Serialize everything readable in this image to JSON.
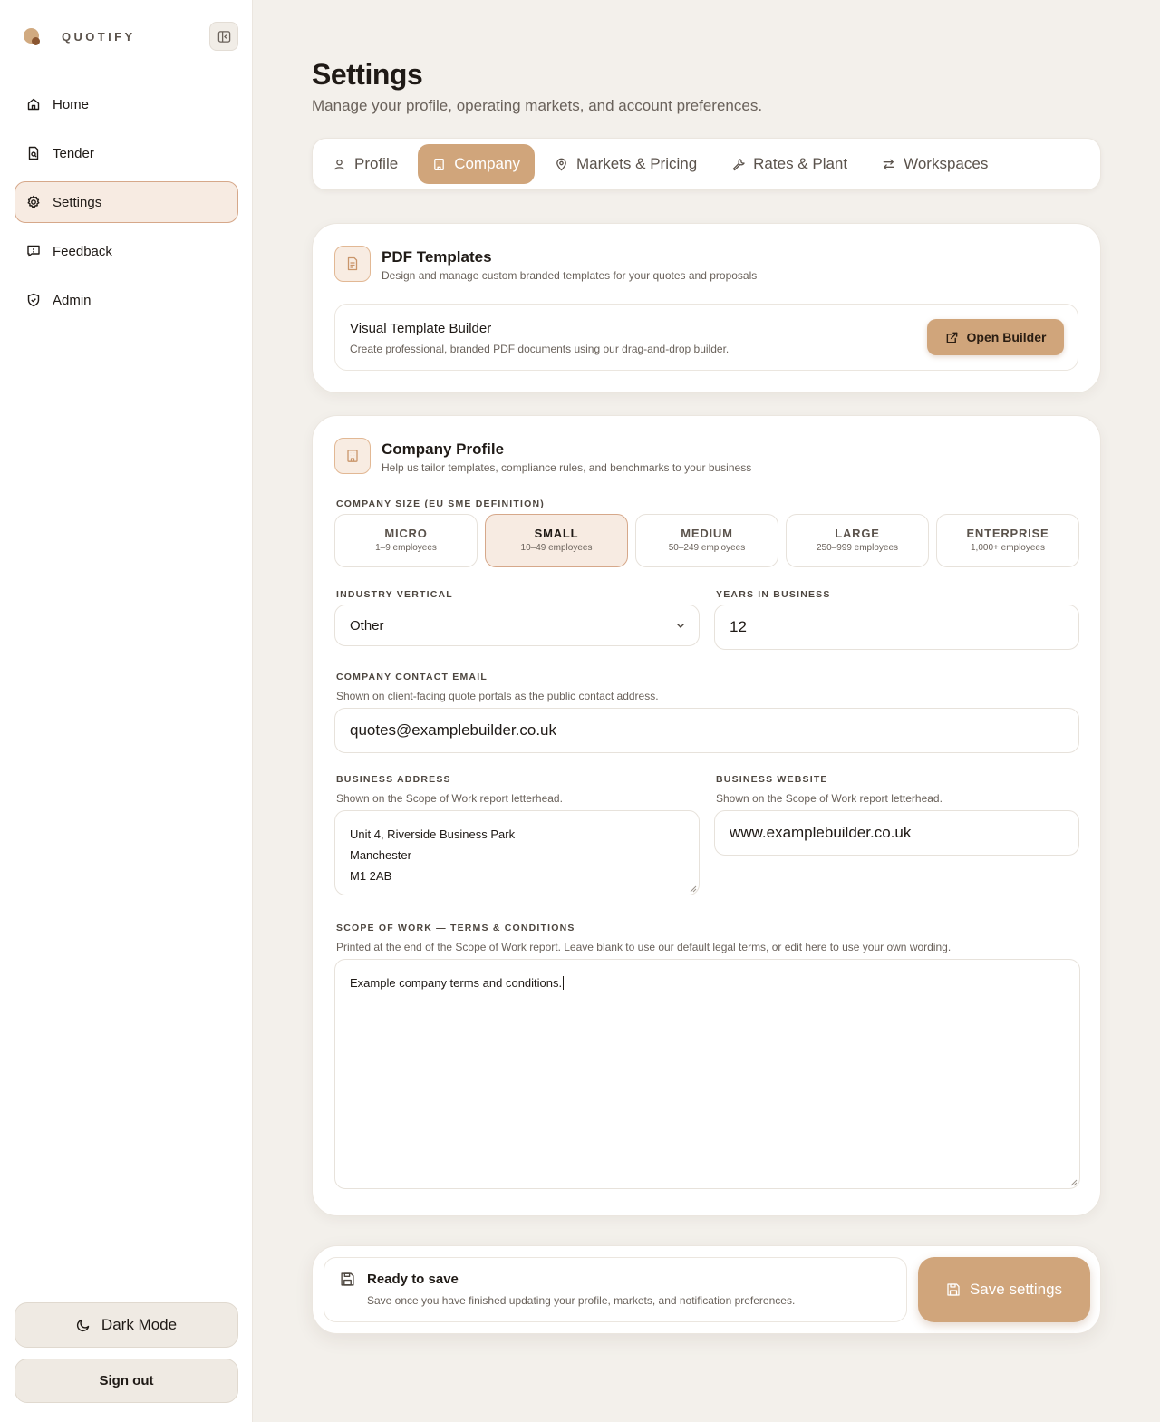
{
  "brand": {
    "name": "QUOTIFY"
  },
  "sidebar": {
    "items": [
      {
        "label": "Home",
        "icon": "home-icon",
        "active": false
      },
      {
        "label": "Tender",
        "icon": "file-icon",
        "active": false
      },
      {
        "label": "Settings",
        "icon": "gear-icon",
        "active": true
      },
      {
        "label": "Feedback",
        "icon": "message-icon",
        "active": false
      },
      {
        "label": "Admin",
        "icon": "shield-icon",
        "active": false
      }
    ],
    "dark_mode_label": "Dark Mode",
    "sign_out_label": "Sign out"
  },
  "header": {
    "title": "Settings",
    "subtitle": "Manage your profile, operating markets, and account preferences."
  },
  "tabs": [
    {
      "label": "Profile",
      "icon": "user-icon",
      "active": false
    },
    {
      "label": "Company",
      "icon": "building-icon",
      "active": true
    },
    {
      "label": "Markets & Pricing",
      "icon": "map-pin-icon",
      "active": false
    },
    {
      "label": "Rates & Plant",
      "icon": "wrench-icon",
      "active": false
    },
    {
      "label": "Workspaces",
      "icon": "swap-icon",
      "active": false
    }
  ],
  "pdf_templates": {
    "title": "PDF Templates",
    "description": "Design and manage custom branded templates for your quotes and proposals",
    "builder_title": "Visual Template Builder",
    "builder_description": "Create professional, branded PDF documents using our drag-and-drop builder.",
    "open_builder_label": "Open Builder"
  },
  "company_profile": {
    "title": "Company Profile",
    "description": "Help us tailor templates, compliance rules, and benchmarks to your business",
    "size_label": "COMPANY SIZE (EU SME DEFINITION)",
    "sizes": [
      {
        "name": "MICRO",
        "range": "1–9 employees",
        "selected": false
      },
      {
        "name": "SMALL",
        "range": "10–49 employees",
        "selected": true
      },
      {
        "name": "MEDIUM",
        "range": "50–249 employees",
        "selected": false
      },
      {
        "name": "LARGE",
        "range": "250–999 employees",
        "selected": false
      },
      {
        "name": "ENTERPRISE",
        "range": "1,000+ employees",
        "selected": false
      }
    ],
    "industry_label": "INDUSTRY VERTICAL",
    "industry_value": "Other",
    "years_label": "YEARS IN BUSINESS",
    "years_value": "12",
    "email_label": "COMPANY CONTACT EMAIL",
    "email_hint": "Shown on client-facing quote portals as the public contact address.",
    "email_value": "quotes@examplebuilder.co.uk",
    "address_label": "BUSINESS ADDRESS",
    "address_hint": "Shown on the Scope of Work report letterhead.",
    "address_lines": [
      "Unit 4, Riverside Business Park",
      "Manchester",
      "M1 2AB"
    ],
    "website_label": "BUSINESS WEBSITE",
    "website_hint": "Shown on the Scope of Work report letterhead.",
    "website_value": "www.examplebuilder.co.uk",
    "terms_label": "SCOPE OF WORK — TERMS & CONDITIONS",
    "terms_hint": "Printed at the end of the Scope of Work report. Leave blank to use our default legal terms, or edit here to use your own wording.",
    "terms_value": "Example company terms and conditions."
  },
  "save_bar": {
    "title": "Ready to save",
    "description": "Save once you have finished updating your profile, markets, and notification preferences.",
    "button_label": "Save settings"
  },
  "colors": {
    "accent": "#d0a57b",
    "background": "#f3f0eb",
    "active_bg": "#f7ebe2"
  }
}
